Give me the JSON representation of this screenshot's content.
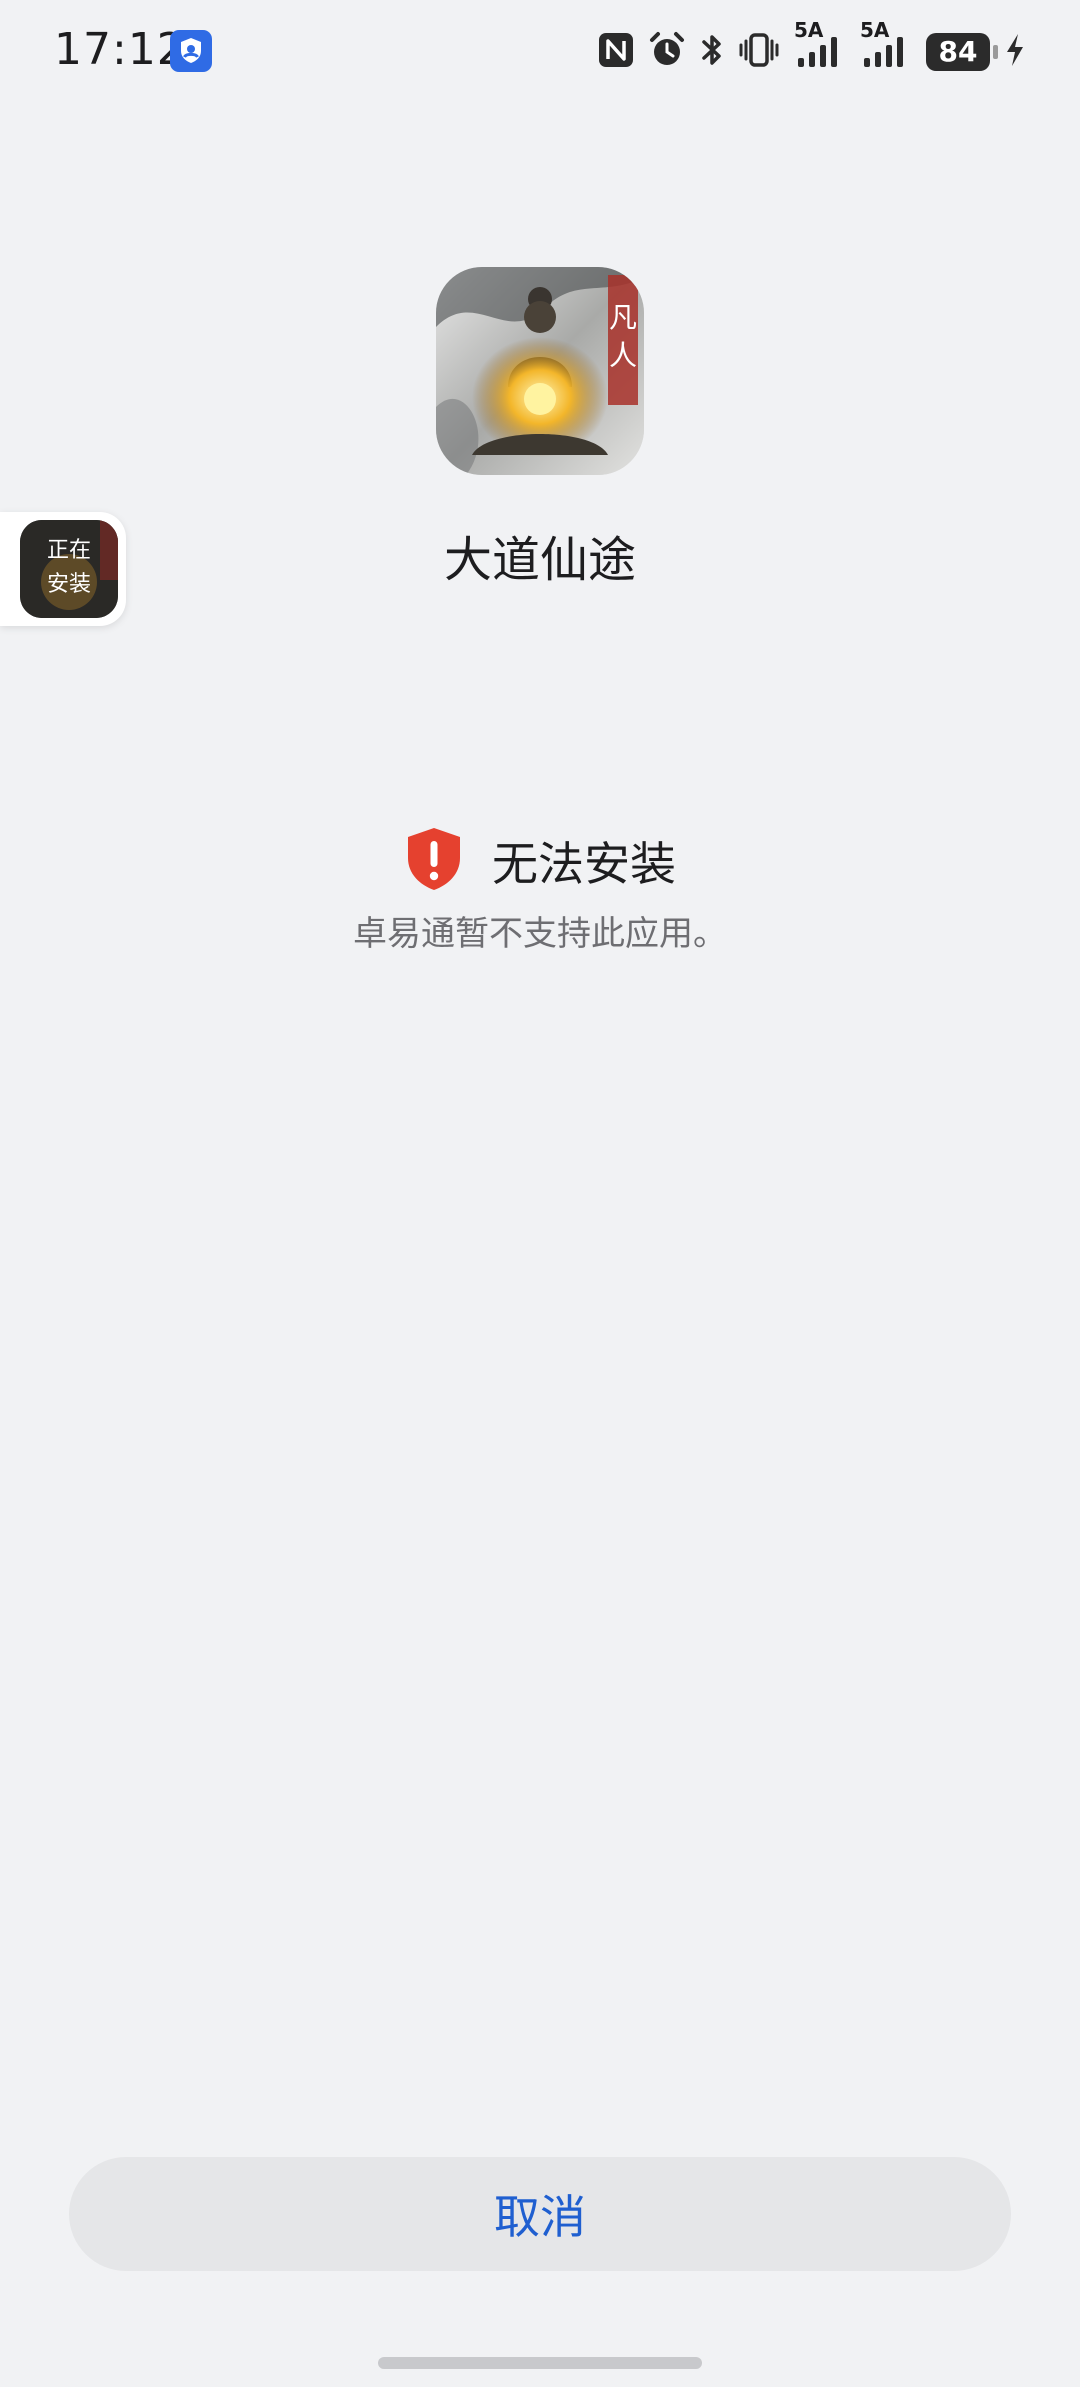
{
  "status_bar": {
    "time": "17:12",
    "signal1_label": "5A",
    "signal2_label": "5A",
    "battery": "84"
  },
  "app": {
    "name": "大道仙途",
    "icon_text": "凡人"
  },
  "floating_task": {
    "line1": "正在",
    "line2": "安装"
  },
  "error": {
    "title": "无法安装",
    "description": "卓易通暂不支持此应用。"
  },
  "actions": {
    "cancel_label": "取消"
  },
  "colors": {
    "background": "#f1f2f4",
    "accent": "#1f5fd0",
    "danger": "#e5412f"
  }
}
